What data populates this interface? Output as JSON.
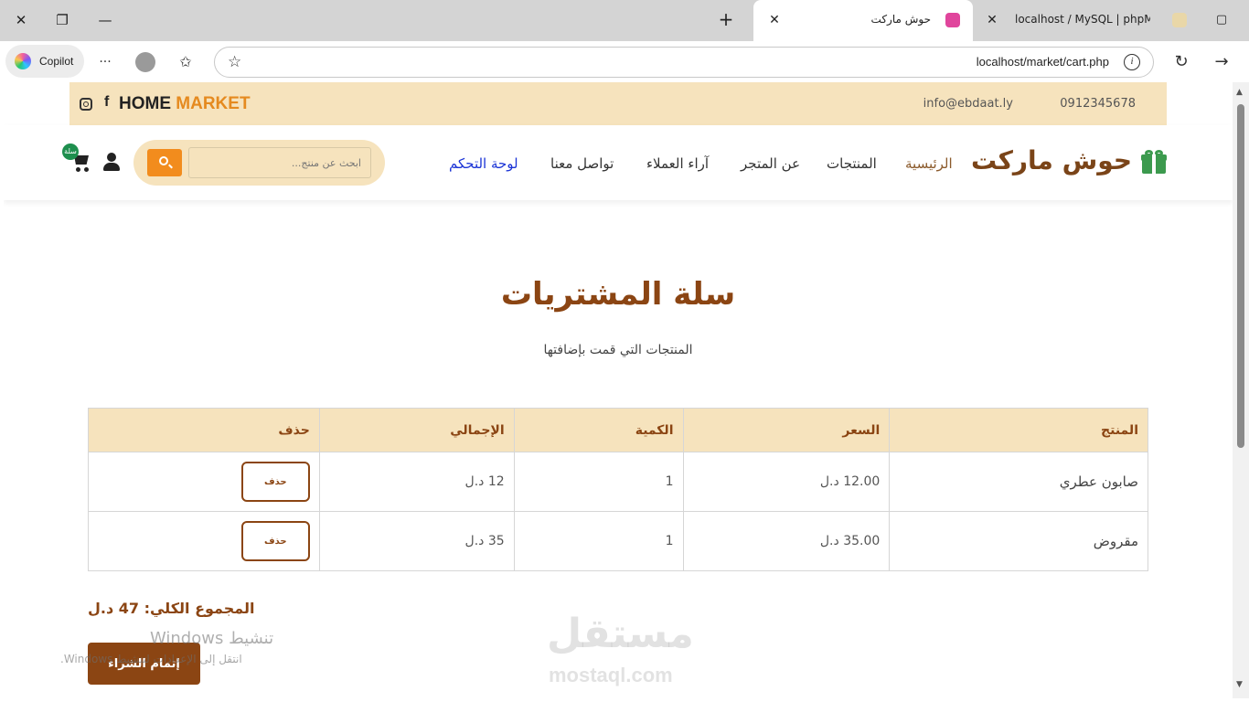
{
  "browser": {
    "copilot_label": "Copilot",
    "url": "localhost/market/cart.php",
    "tabs": [
      {
        "title": "حوش ماركت",
        "active": true
      },
      {
        "title": "localhost / MySQL | phpMy",
        "active": false
      }
    ],
    "window_controls": {
      "close": "✕",
      "restore": "❐",
      "minimize": "—"
    },
    "icons": {
      "more": "···",
      "newtab": "+",
      "refresh": "↻",
      "forward": "→",
      "star": "☆",
      "favorites": "✩"
    }
  },
  "topbar": {
    "phone": "0912345678",
    "email": "info@ebdaat.ly",
    "brand_main": "HOME",
    "brand_accent": "MARKET",
    "fb_glyph": "f"
  },
  "navbar": {
    "logo": "حوش ماركت",
    "links": [
      "الرئيسية",
      "المنتجات",
      "عن المتجر",
      "آراء العملاء",
      "تواصل معنا",
      "لوحة التحكم"
    ],
    "search_placeholder": "ابحث عن منتج...",
    "cart_badge": "سلة"
  },
  "cart": {
    "title": "سلة المشتريات",
    "subtitle": "المنتجات التي قمت بإضافتها",
    "headers": [
      "المنتج",
      "السعر",
      "الكمية",
      "الإجمالي",
      "حذف"
    ],
    "rows": [
      {
        "product": "صابون عطري",
        "price": "12.00 د.ل",
        "qty": "1",
        "total": "12 د.ل",
        "delete": "حذف"
      },
      {
        "product": "مقروض",
        "price": "35.00 د.ل",
        "qty": "1",
        "total": "35 د.ل",
        "delete": "حذف"
      }
    ],
    "grand_total": "المجموع الكلي: 47 د.ل",
    "checkout": "إتمام الشراء"
  },
  "overlay": {
    "activate_title": "تنشيط Windows",
    "activate_sub": "انتقل إلى الإعدادات لتنشيط Windows.",
    "watermark_ar": "مستقل",
    "watermark_en": "mostaql.com"
  },
  "colors": {
    "accent_brown": "#8b4513",
    "cream": "#f6e3bd",
    "orange": "#f28c1d",
    "green": "#3c9a4e",
    "dashboard_link": "#1a33d6",
    "home_link": "#8b5a2b"
  }
}
